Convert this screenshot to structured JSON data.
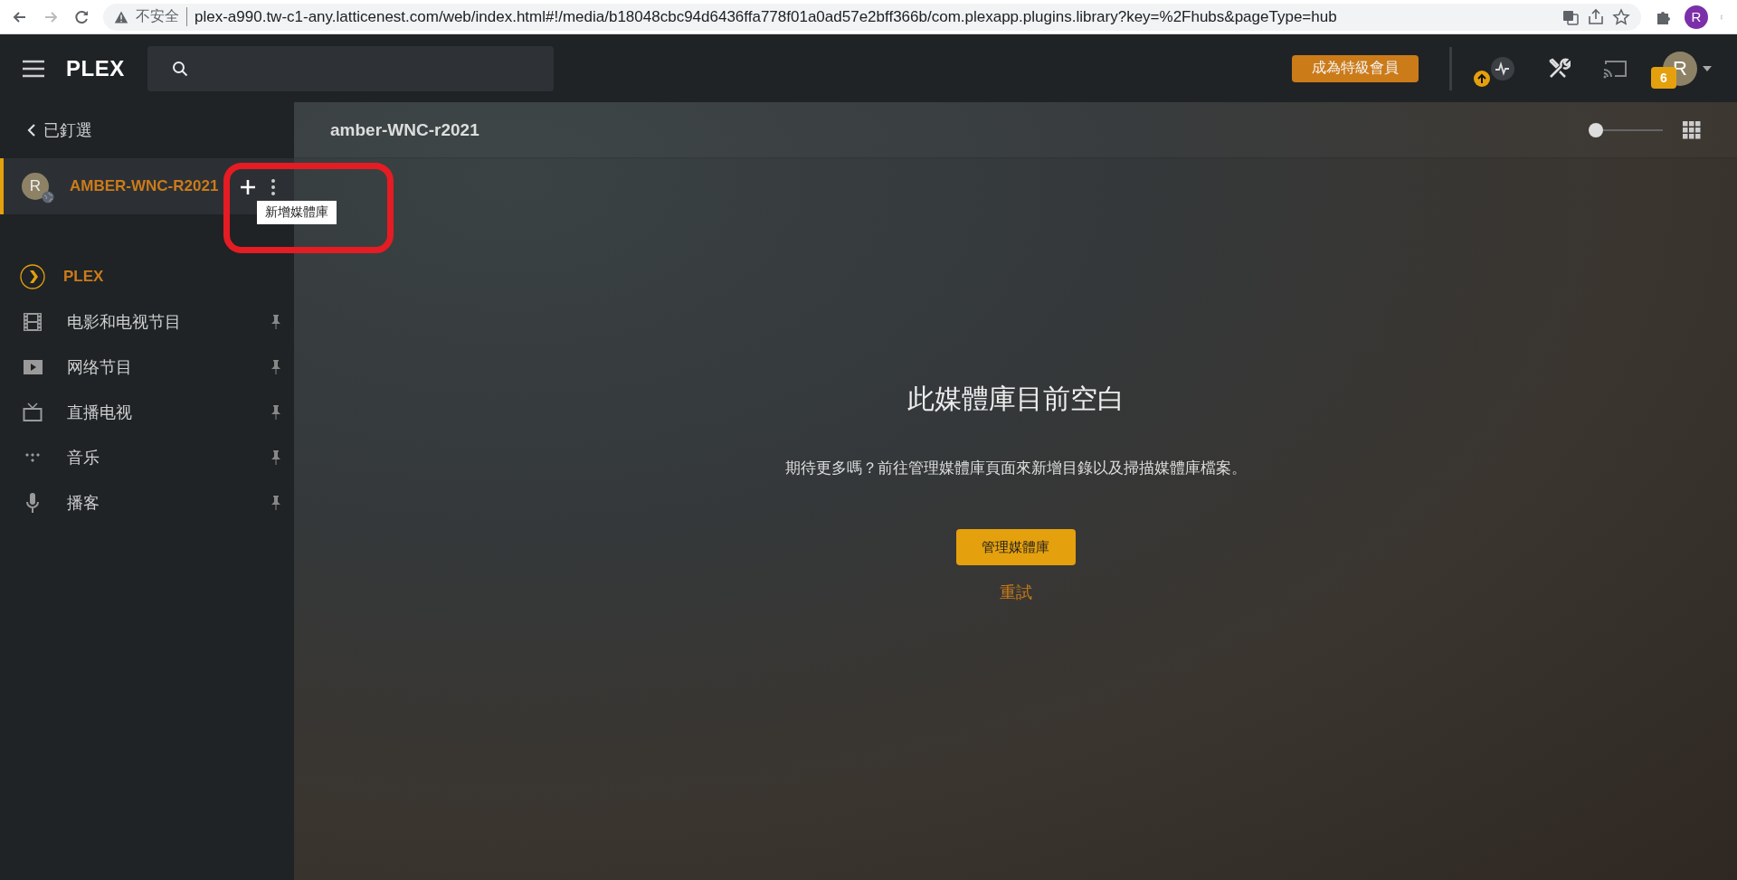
{
  "browser": {
    "security": "不安全",
    "url": "plex-a990.tw-c1-any.latticenest.com/web/index.html#!/media/b18048cbc94d6436ffa778f01a0ad57e2bff366b/com.plexapp.plugins.library?key=%2Fhubs&pageType=hub",
    "profile_initial": "R"
  },
  "header": {
    "logo": "PLEX",
    "premium_button": "成為特級會員",
    "notification_count": "6",
    "avatar_initial": "R"
  },
  "sidebar": {
    "back_link": "已釘選",
    "server": {
      "name": "AMBER-WNC-R2021",
      "avatar_initial": "R",
      "selected": true,
      "tooltip": "新增媒體庫"
    },
    "items": [
      {
        "kind": "plex",
        "label": "PLEX"
      },
      {
        "kind": "movies",
        "label": "电影和电视节目"
      },
      {
        "kind": "web",
        "label": "网络节目"
      },
      {
        "kind": "livetv",
        "label": "直播电视"
      },
      {
        "kind": "music",
        "label": "音乐"
      },
      {
        "kind": "podcast",
        "label": "播客"
      }
    ]
  },
  "main": {
    "title": "amber-WNC-r2021",
    "size_slider": {
      "level": 0
    },
    "empty_state": {
      "heading": "此媒體庫目前空白",
      "message": "期待更多嗎？前往管理媒體庫頁面來新增目錄以及掃描媒體庫檔案。",
      "manage_button": "管理媒體庫",
      "retry_link": "重試"
    }
  }
}
